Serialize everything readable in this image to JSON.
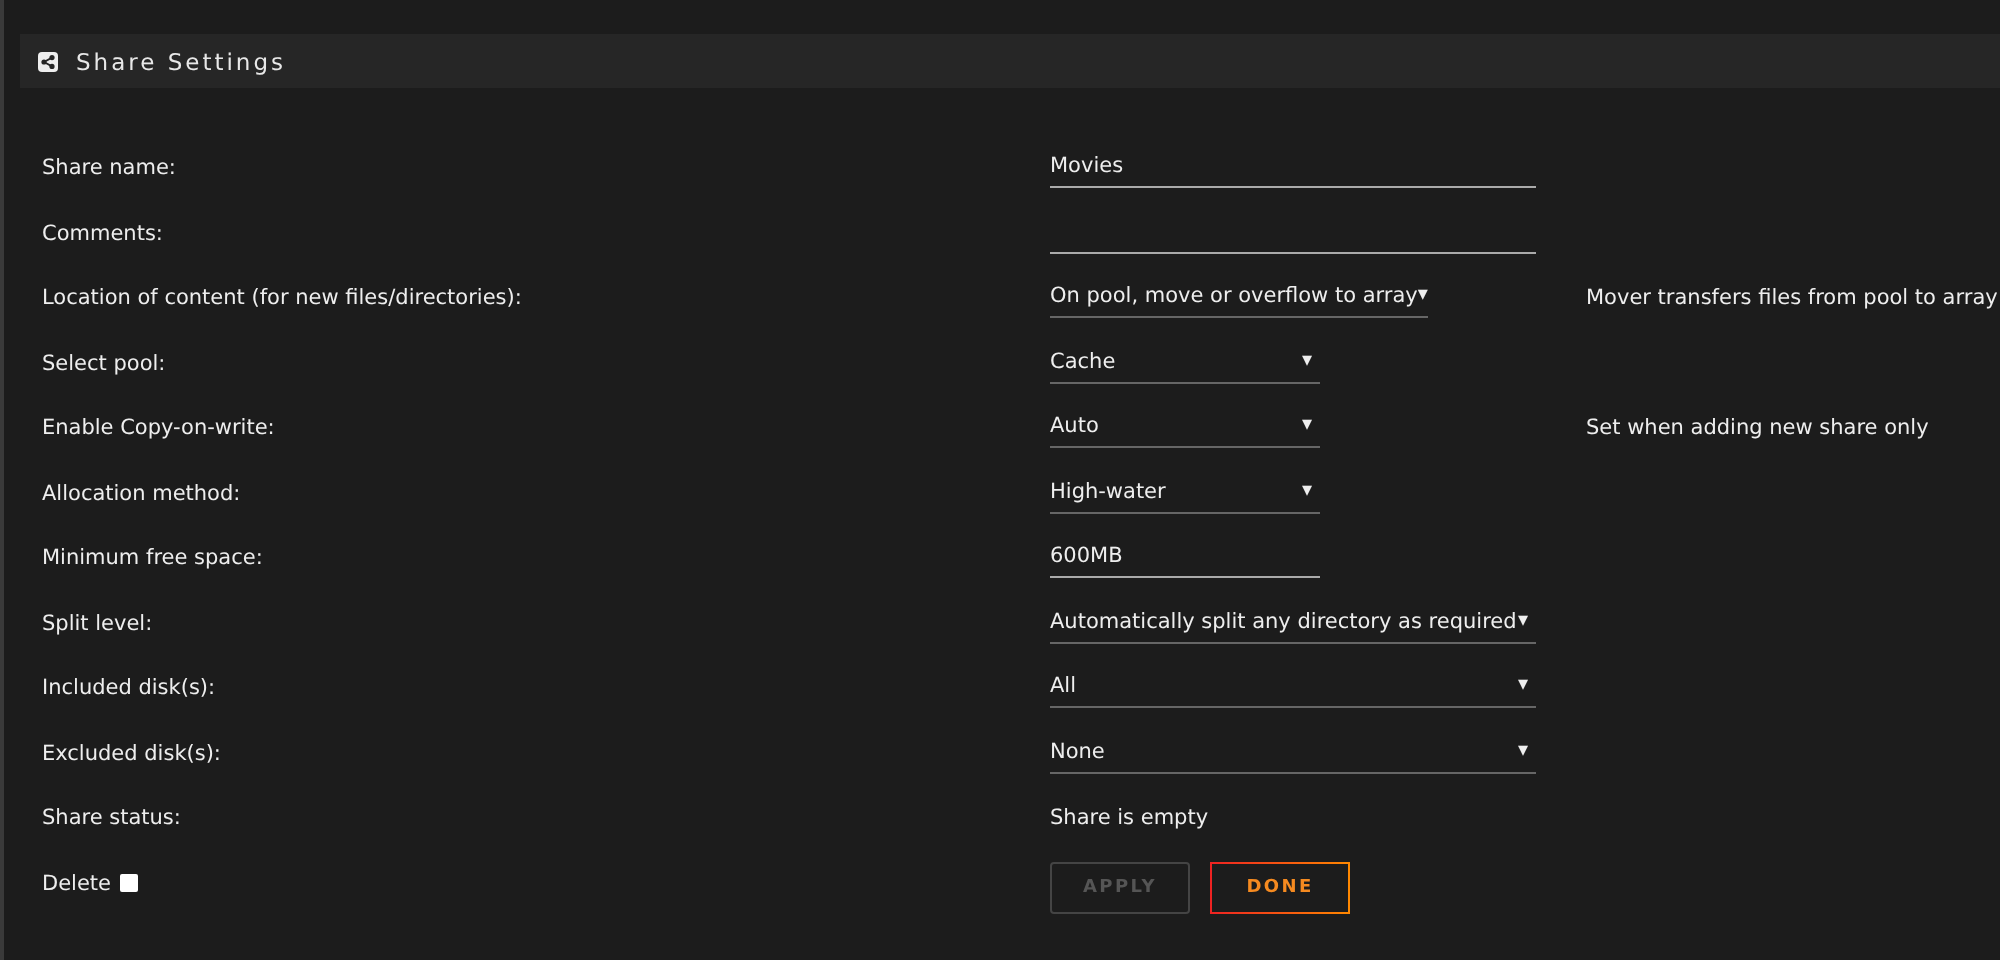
{
  "header": {
    "title": "Share Settings"
  },
  "rows": [
    {
      "label": "Share name:",
      "kind": "input",
      "value": "Movies"
    },
    {
      "label": "Comments:",
      "kind": "input"
    },
    {
      "label": "Location of content (for new files/directories):",
      "kind": "select",
      "value": "On pool, move or overflow to array",
      "arrow": "▾",
      "note": "Mover transfers files from pool to array"
    },
    {
      "label": "Select pool:",
      "kind": "select",
      "value": "Cache",
      "arrow": "▾"
    },
    {
      "label": "Enable Copy-on-write:",
      "kind": "select",
      "value": "Auto",
      "arrow": "▾",
      "note": "Set when adding new share only"
    },
    {
      "label": "Allocation method:",
      "kind": "select",
      "value": "High-water",
      "arrow": "▾"
    },
    {
      "label": "Minimum free space:",
      "kind": "input",
      "value": "600MB"
    },
    {
      "label": "Split level:",
      "kind": "select",
      "value": "Automatically split any directory as required",
      "arrow": "▾"
    },
    {
      "label": "Included disk(s):",
      "kind": "select",
      "value": "All",
      "arrow": "▾"
    },
    {
      "label": "Excluded disk(s):",
      "kind": "select",
      "value": "None",
      "arrow": "▾"
    },
    {
      "label": "Share status:",
      "kind": "text",
      "value": "Share is empty"
    }
  ],
  "delete": {
    "label": "Delete",
    "checked": false
  },
  "buttons": [
    {
      "label": "APPLY",
      "disabled": true
    },
    {
      "label": "DONE",
      "disabled": false
    }
  ]
}
